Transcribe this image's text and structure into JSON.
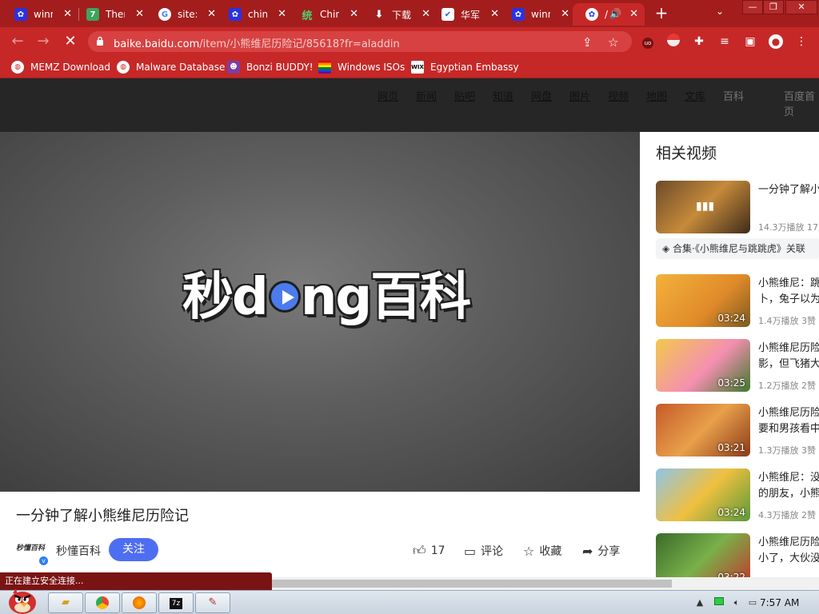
{
  "tabs": [
    {
      "title": "winn",
      "icon": "baidu-icon",
      "color": "#2932e1"
    },
    {
      "title": "Ther",
      "icon": "seven-icon",
      "color": "#3ba55c"
    },
    {
      "title": "site:",
      "icon": "google-icon",
      "color": "#ffffff"
    },
    {
      "title": "china",
      "icon": "baidu-icon",
      "color": "#2932e1"
    },
    {
      "title": "Chin",
      "icon": "china-icon",
      "color": "#1d9e34"
    },
    {
      "title": "下载",
      "icon": "download-icon",
      "color": "#ffffff"
    },
    {
      "title": "华军",
      "icon": "huajun-icon",
      "color": "#1d64d9"
    },
    {
      "title": "winn",
      "icon": "baidu-icon",
      "color": "#2932e1"
    },
    {
      "title": "/",
      "icon": "baidu-icon",
      "color": "#2932e1"
    }
  ],
  "toolbar": {
    "url_domain": "baike.baidu.com",
    "url_path": "/item/小熊维尼历险记/85618?fr=aladdin"
  },
  "bookmarks": [
    {
      "label": "MEMZ Download",
      "icon": "globe-icon"
    },
    {
      "label": "Malware Database",
      "icon": "globe-icon"
    },
    {
      "label": "Bonzi BUDDY!",
      "icon": "bonzi-icon"
    },
    {
      "label": "Windows ISOs",
      "icon": "rainbow-flag-icon"
    },
    {
      "label": "Egyptian Embassy",
      "icon": "wix-icon"
    }
  ],
  "topnav": {
    "links": [
      "网页",
      "新闻",
      "贴吧",
      "知道",
      "网盘",
      "图片",
      "视频",
      "地图",
      "文库"
    ],
    "current": "百科",
    "right": "百度首页"
  },
  "player": {
    "logo_a": "秒d",
    "logo_b": "ng百科"
  },
  "video": {
    "title": "一分钟了解小熊维尼历险记",
    "author_badge": "秒懂百科",
    "author": "秒懂百科",
    "follow": "关注",
    "verified_mark": "v",
    "likes": "17",
    "comment": "评论",
    "collect": "收藏",
    "share": "分享"
  },
  "related": {
    "heading": "相关视频",
    "collection": "合集·《小熊维尼与跳跳虎》关联",
    "items": [
      {
        "line1": "一分钟了解小",
        "line2": "",
        "meta": "14.3万播放 17",
        "duration": ""
      },
      {
        "line1": "小熊维尼：跳",
        "line2": "卜，兔子以为",
        "meta": "1.4万播放 3赞",
        "duration": "03:24"
      },
      {
        "line1": "小熊维尼历险",
        "line2": "影，但飞猪大",
        "meta": "1.2万播放 2赞",
        "duration": "03:25"
      },
      {
        "line1": "小熊维尼历险",
        "line2": "要和男孩看中",
        "meta": "1.3万播放 3赞",
        "duration": "03:21"
      },
      {
        "line1": "小熊维尼：没",
        "line2": "的朋友，小熊",
        "meta": "4.3万播放 2赞",
        "duration": "03:24"
      },
      {
        "line1": "小熊维尼历险",
        "line2": "小了，大伙没",
        "meta": "",
        "duration": "03:22"
      }
    ]
  },
  "status": {
    "text": "正在建立安全连接..."
  },
  "taskbar": {
    "clock": "7:57 AM",
    "zip_label": "7z"
  },
  "colors": {
    "chrome": "#c62828",
    "tabstrip": "#a31d1d",
    "follow": "#4e6ef2"
  }
}
